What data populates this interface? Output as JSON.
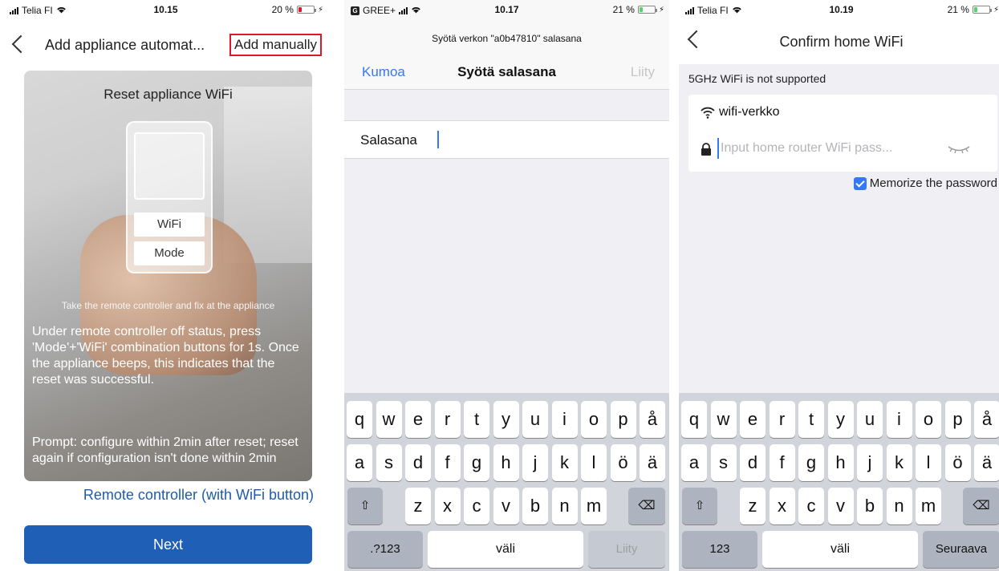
{
  "screen1": {
    "status": {
      "carrier": "Telia FI",
      "time": "10.15",
      "battery": "20 %",
      "battery_level": 0.2,
      "battery_color": "#e0162b"
    },
    "nav": {
      "title": "Add appliance automat...",
      "add_manually": "Add manually"
    },
    "card": {
      "title": "Reset appliance WiFi",
      "remote_buttons": [
        "WiFi",
        "Mode"
      ],
      "caption": "Take the remote controller and fix at the appliance",
      "description": "Under remote controller off status, press 'Mode'+'WiFi' combination buttons for 1s. Once the appliance beeps, this indicates that the reset was successful.",
      "prompt": "Prompt: configure within 2min after reset; reset again if configuration isn't done within 2min"
    },
    "remote_link": "Remote controller (with WiFi button)",
    "next_button": "Next",
    "accent_color": "#1f5fb5"
  },
  "screen2": {
    "status": {
      "carrier": "GREE+",
      "time": "10.17",
      "battery": "21 %",
      "battery_level": 0.21,
      "battery_color": "#4cd964"
    },
    "subtitle": "Syötä verkon \"a0b47810\" salasana",
    "cancel": "Kumoa",
    "title": "Syötä salasana",
    "join": "Liity",
    "password_label": "Salasana",
    "keyboard": {
      "row1": [
        "q",
        "w",
        "e",
        "r",
        "t",
        "y",
        "u",
        "i",
        "o",
        "p",
        "å"
      ],
      "row2": [
        "a",
        "s",
        "d",
        "f",
        "g",
        "h",
        "j",
        "k",
        "l",
        "ö",
        "ä"
      ],
      "row3": [
        "z",
        "x",
        "c",
        "v",
        "b",
        "n",
        "m"
      ],
      "shift": "⇧",
      "backspace": "⌫",
      "numbers": ".?123",
      "space": "väli",
      "return": "Liity"
    }
  },
  "screen3": {
    "status": {
      "carrier": "Telia FI",
      "time": "10.19",
      "battery": "21 %",
      "battery_level": 0.21,
      "battery_color": "#4cd964"
    },
    "title": "Confirm home WiFi",
    "note": "5GHz WiFi is not supported",
    "ssid": "wifi-verkko",
    "password_placeholder": "Input home router WiFi pass...",
    "memorize": "Memorize the password",
    "memorize_checked": true,
    "keyboard": {
      "row1": [
        "q",
        "w",
        "e",
        "r",
        "t",
        "y",
        "u",
        "i",
        "o",
        "p",
        "å"
      ],
      "row2": [
        "a",
        "s",
        "d",
        "f",
        "g",
        "h",
        "j",
        "k",
        "l",
        "ö",
        "ä"
      ],
      "row3": [
        "z",
        "x",
        "c",
        "v",
        "b",
        "n",
        "m"
      ],
      "shift": "⇧",
      "backspace": "⌫",
      "numbers": "123",
      "space": "väli",
      "return": "Seuraava"
    }
  }
}
